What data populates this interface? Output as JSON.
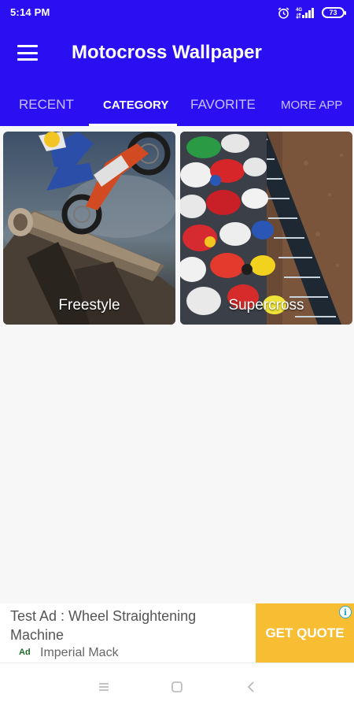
{
  "status_bar": {
    "time": "5:14 PM",
    "battery": "73",
    "icons": [
      "alarm-icon",
      "signal-icon",
      "battery-icon"
    ]
  },
  "app_bar": {
    "title": "Motocross Wallpaper",
    "menu_icon": "menu-icon",
    "color": "#2a0ff2"
  },
  "tabs": [
    {
      "label": "RECENT",
      "active": false
    },
    {
      "label": "CATEGORY",
      "active": true
    },
    {
      "label": "FAVORITE",
      "active": false
    },
    {
      "label": "MORE APP",
      "active": false
    }
  ],
  "categories": [
    {
      "label": "Freestyle"
    },
    {
      "label": "Supercross"
    }
  ],
  "ad": {
    "title": "Test Ad : Wheel Straightening Machine",
    "badge": "Ad",
    "advertiser": "Imperial Mack",
    "cta": "GET QUOTE",
    "info_icon": "info-icon",
    "cta_color": "#f7bd33"
  },
  "nav_bar": {
    "buttons": [
      "recent-apps-icon",
      "home-icon",
      "back-icon"
    ]
  }
}
